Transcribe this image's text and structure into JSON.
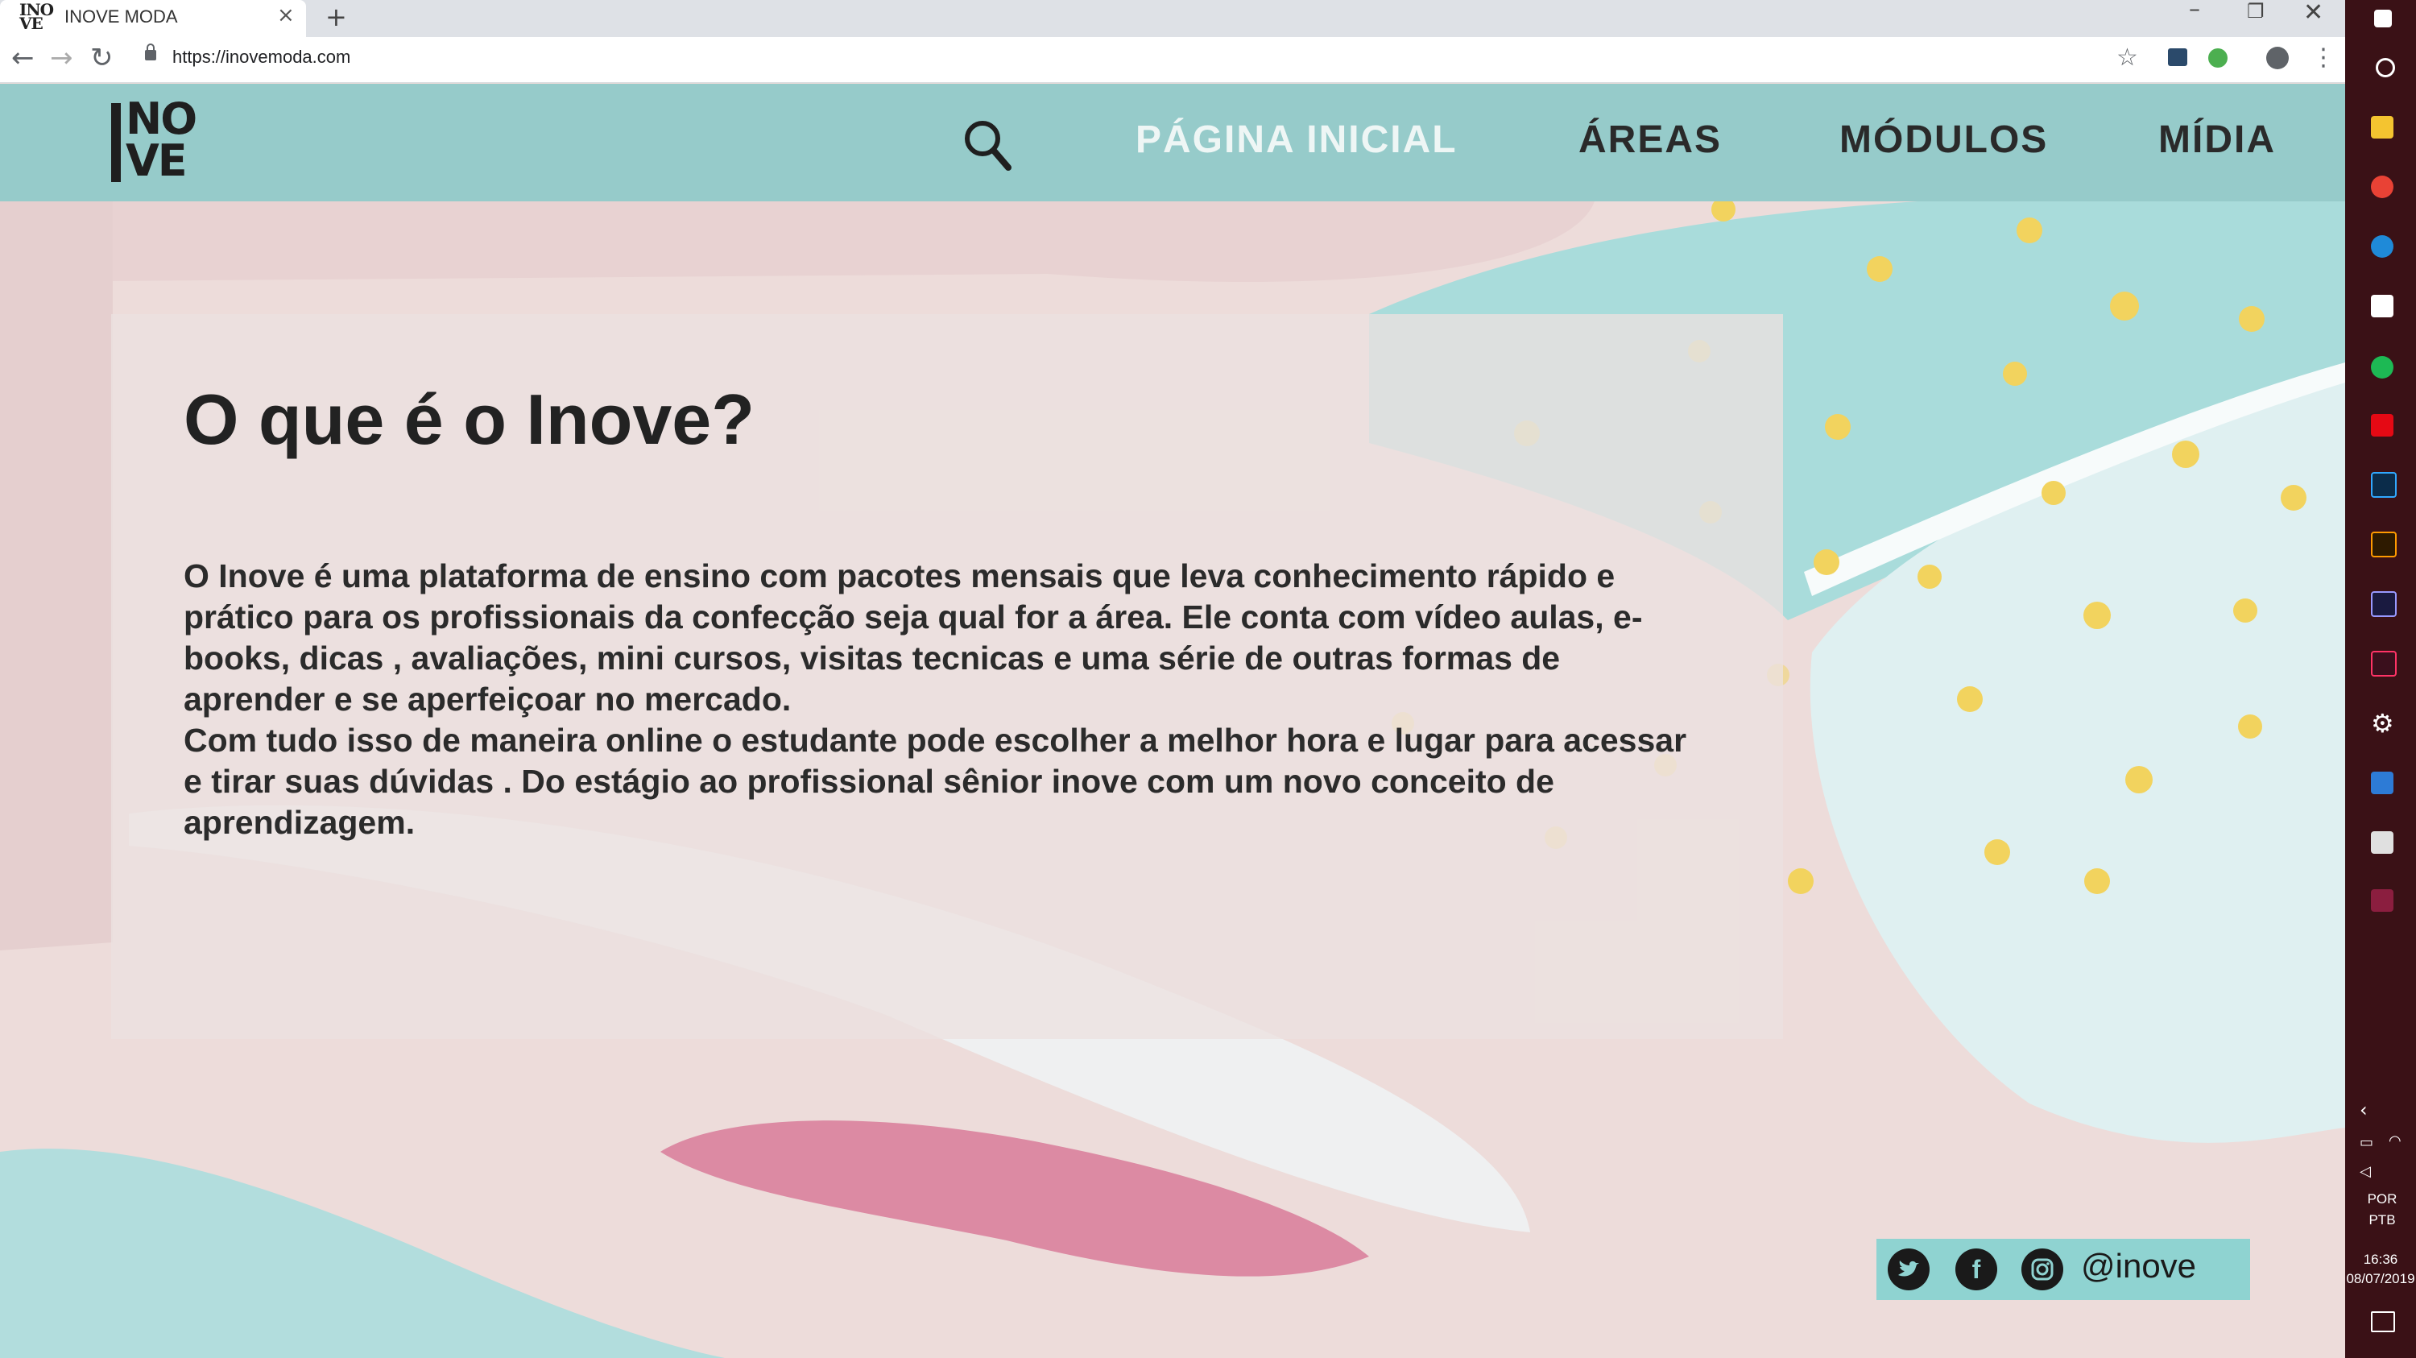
{
  "browser": {
    "tab_title": "INOVE MODA",
    "favicon_text": "INO VE",
    "close_glyph": "×",
    "new_tab_glyph": "+",
    "url": "https://inovemoda.com",
    "window_controls": {
      "minimize": "–",
      "maximize": "❐",
      "close": "✕"
    },
    "nav_glyphs": {
      "back": "←",
      "forward": "→",
      "reload": "↻",
      "star": "☆",
      "menu": "⋮"
    }
  },
  "site": {
    "logo": {
      "line1": "NO",
      "line2": "VE"
    },
    "nav": {
      "search_icon": "search-icon",
      "items": [
        "PÁGINA INICIAL",
        "ÁREAS",
        "MÓDULOS",
        "MÍDIA"
      ],
      "active_color": "#eef6f5"
    },
    "colors": {
      "header": "#96cbca",
      "background": "#eddcda",
      "teal": "#a9dcdb",
      "pink": "#dc8aa3",
      "dots": "#f2d35e"
    }
  },
  "content": {
    "heading": "O que é o Inove?",
    "paragraph1": "O Inove é uma plataforma de ensino com pacotes mensais que leva conhecimento rápido e prático para os profissionais da confecção seja qual for a área. Ele conta com vídeo aulas, e-books, dicas , avaliações, mini cursos, visitas tecnicas e uma série de outras formas de aprender e se aperfeiçoar no mercado.",
    "paragraph2": "Com tudo isso de maneira online o estudante pode escolher a melhor hora e lugar para acessar e tirar suas dúvidas . Do estágio ao profissional sênior inove com um novo conceito de aprendizagem."
  },
  "social": {
    "icons": [
      "twitter-icon",
      "facebook-icon",
      "instagram-icon"
    ],
    "fb_glyph": "f",
    "handle": "@inove"
  },
  "taskbar": {
    "settings_glyph": "⚙",
    "chevron": "‹",
    "lang1": "POR",
    "lang2": "PTB",
    "time": "16:36",
    "date": "08/07/2019"
  }
}
